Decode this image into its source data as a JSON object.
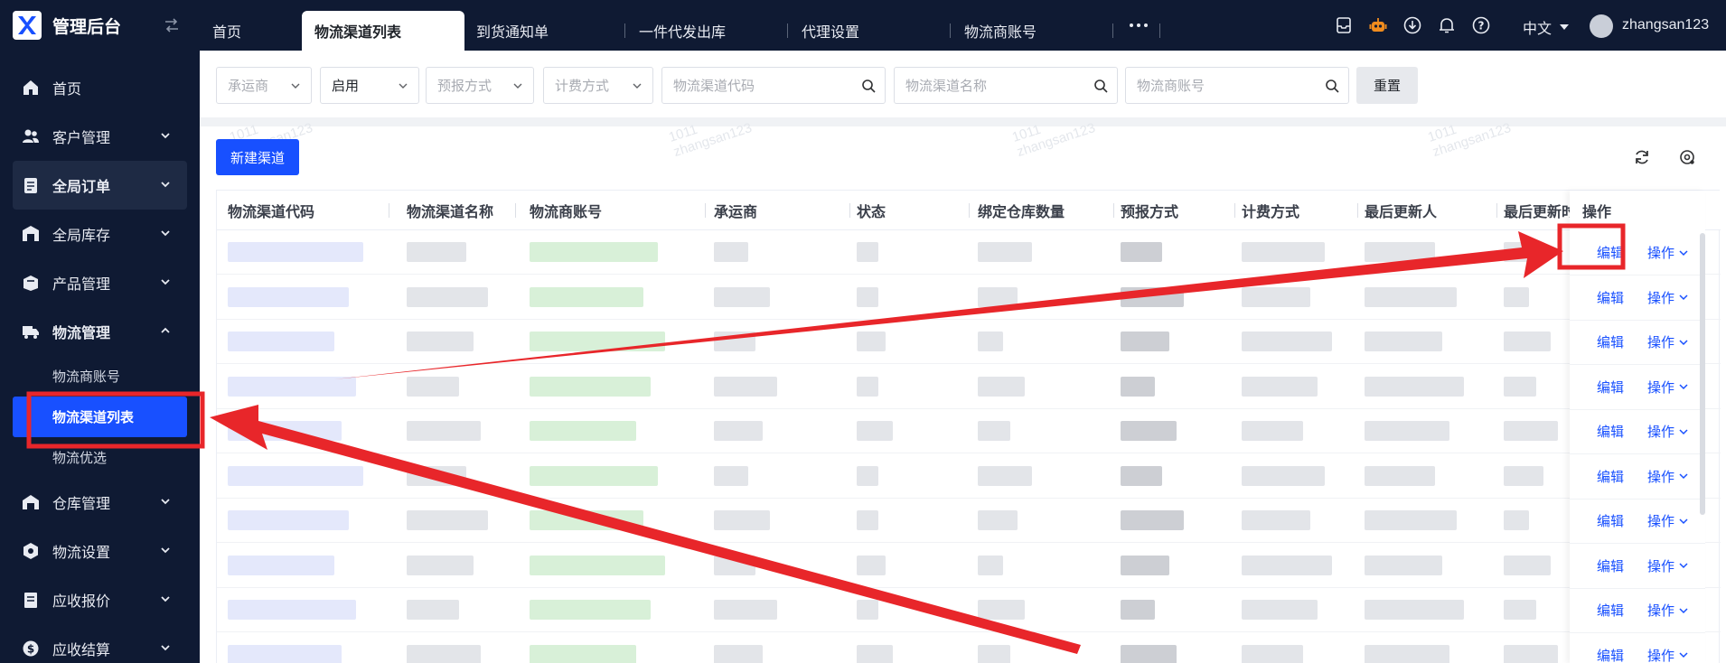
{
  "app": {
    "title": "管理后台"
  },
  "sidebar": {
    "items": [
      {
        "label": "首页",
        "icon": "home-icon"
      },
      {
        "label": "客户管理",
        "icon": "users-icon"
      },
      {
        "label": "全局订单",
        "icon": "order-icon"
      },
      {
        "label": "全局库存",
        "icon": "inventory-icon"
      },
      {
        "label": "产品管理",
        "icon": "product-icon"
      },
      {
        "label": "物流管理",
        "icon": "truck-icon"
      },
      {
        "label": "仓库管理",
        "icon": "warehouse-icon"
      },
      {
        "label": "物流设置",
        "icon": "settings-icon"
      },
      {
        "label": "应收报价",
        "icon": "quote-icon"
      },
      {
        "label": "应收结算",
        "icon": "dollar-icon"
      }
    ],
    "sub_items": [
      "物流商账号",
      "物流渠道列表",
      "物流优选"
    ]
  },
  "tabs": [
    "首页",
    "物流渠道列表",
    "到货通知单",
    "一件代发出库",
    "代理设置",
    "物流商账号"
  ],
  "header": {
    "language": "中文",
    "username": "zhangsan123"
  },
  "filters": {
    "carrier_placeholder": "承运商",
    "status_value": "启用",
    "forecast_placeholder": "预报方式",
    "billing_placeholder": "计费方式",
    "channel_code_placeholder": "物流渠道代码",
    "channel_name_placeholder": "物流渠道名称",
    "provider_account_placeholder": "物流商账号",
    "reset_label": "重置"
  },
  "toolbar": {
    "new_channel_label": "新建渠道"
  },
  "watermark": {
    "line1": "1011",
    "line2": "zhangsan123"
  },
  "table": {
    "columns": [
      "物流渠道代码",
      "物流渠道名称",
      "物流商账号",
      "承运商",
      "状态",
      "绑定仓库数量",
      "预报方式",
      "计费方式",
      "最后更新人",
      "最后更新时"
    ],
    "op_column": "操作",
    "edit_label": "编辑",
    "more_label": "操作",
    "row_count": 10
  },
  "colors": {
    "accent": "#1850ff",
    "sidebar_bg": "#0f1a33",
    "annotation": "#e8262a"
  }
}
